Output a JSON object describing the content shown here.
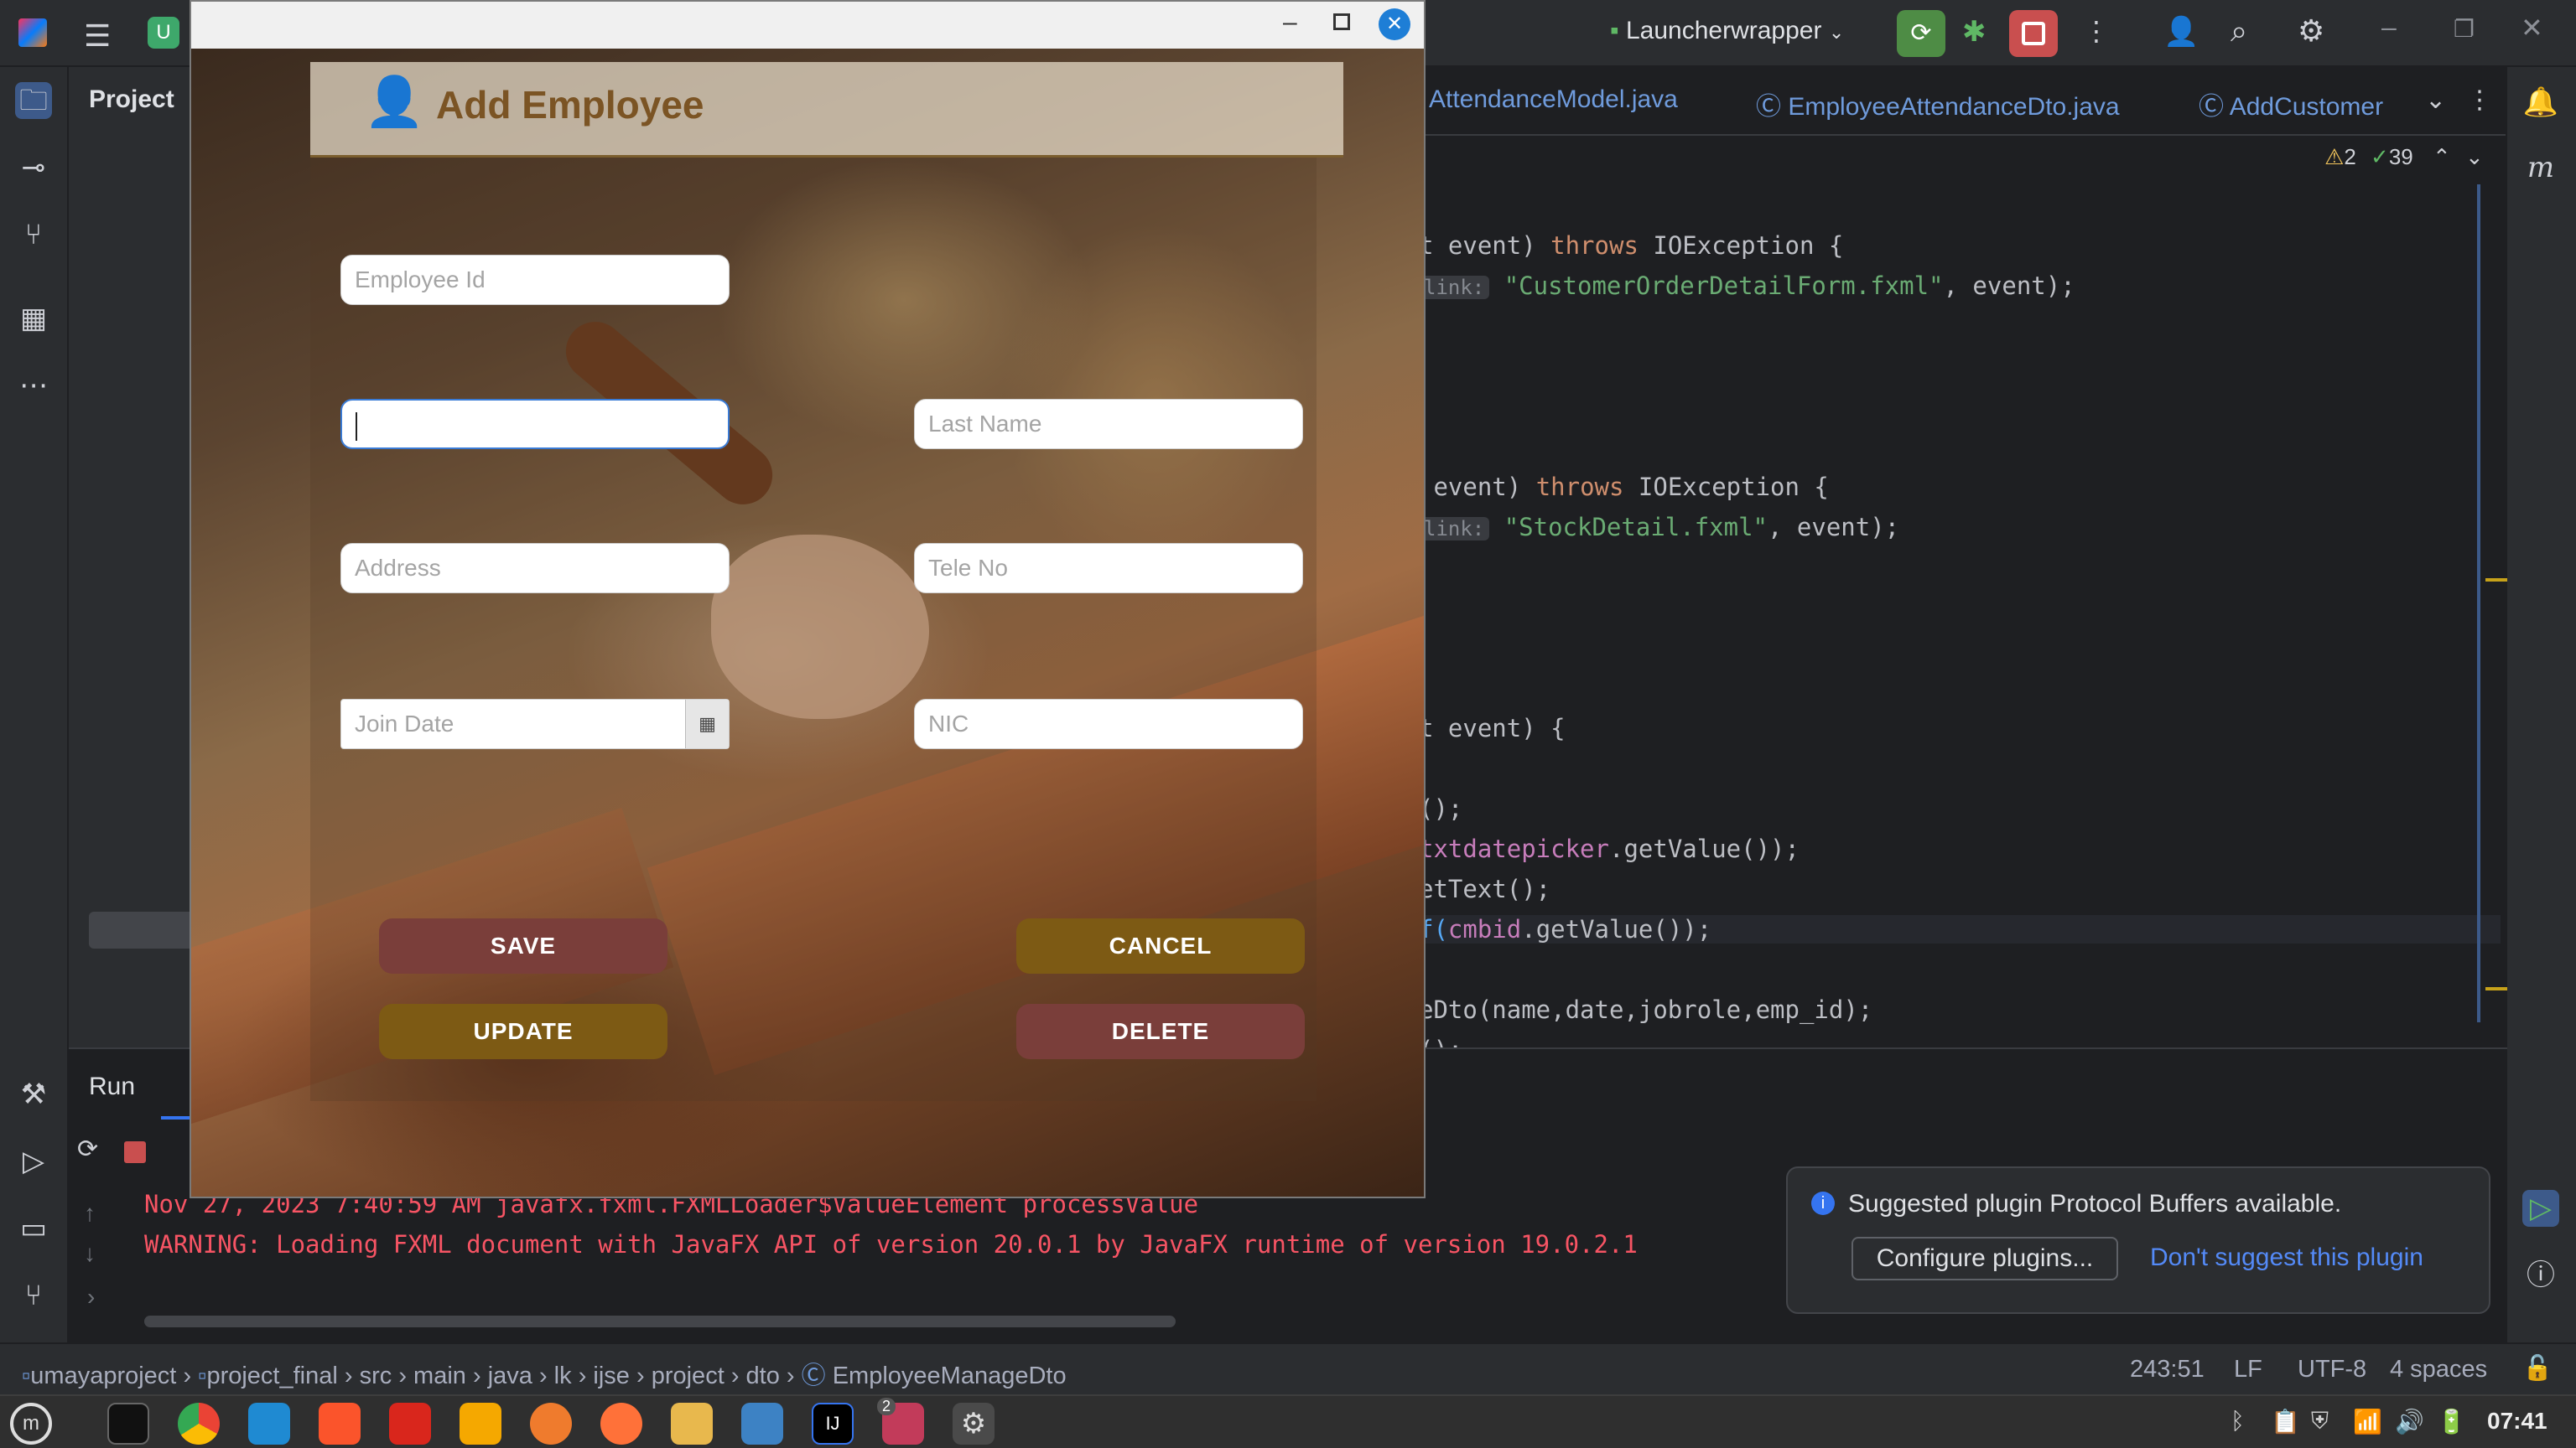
{
  "ide": {
    "run_config": "Launcherwrapper",
    "project_label": "Project",
    "tabs": [
      "AttendanceModel.java",
      "EmployeeAttendanceDto.java",
      "AddCustomer("
    ],
    "inspections": {
      "warnings": "2",
      "ok": "39"
    },
    "code_lines": [
      {
        "pre": "t event) ",
        "kw": "throws",
        "post": " IOException {"
      },
      {
        "hint": "link:",
        "str": "\"CustomerOrderDetailForm.fxml\"",
        "post": ", event);"
      },
      {
        "pre": " event) ",
        "kw": "throws",
        "post": " IOException {"
      },
      {
        "hint": "link:",
        "str": "\"StockDetail.fxml\"",
        "post": ", event);"
      },
      {
        "pre": "t event) {"
      },
      {
        "pre": "();"
      },
      {
        "fn": "txtdatepicker",
        "post": ".getValue());"
      },
      {
        "pre": "etText();"
      },
      {
        "fn": "f(",
        "pur": "cmbid",
        "post": ".getValue());"
      },
      {
        "pre": "eDto(name,date,jobrole,emp_id);"
      },
      {
        "pre": "();"
      }
    ],
    "run": {
      "tab_label": "Run",
      "lines": [
        "Nov 27, 2023 7:40:59 AM javafx.fxml.FXMLLoader$ValueElement processValue",
        "WARNING: Loading FXML document with JavaFX API of version 20.0.1 by JavaFX runtime of version 19.0.2.1"
      ]
    },
    "notification": {
      "message": "Suggested plugin Protocol Buffers available.",
      "configure_label": "Configure plugins...",
      "dismiss_label": "Don't suggest this plugin"
    },
    "breadcrumbs": [
      "umayaproject",
      "project_final",
      "src",
      "main",
      "java",
      "lk",
      "ijse",
      "project",
      "dto",
      "EmployeeManageDto"
    ],
    "status": {
      "position": "243:51",
      "line_sep": "LF",
      "encoding": "UTF-8",
      "indent": "4 spaces"
    },
    "clock": "07:41",
    "taskbar_badge": "2"
  },
  "app": {
    "title": "Add Employee",
    "fields": {
      "employee_id": "Employee Id",
      "first_name": "",
      "last_name": "Last Name",
      "address": "Address",
      "tele_no": "Tele No",
      "join_date": "Join Date",
      "nic": "NIC"
    },
    "buttons": {
      "save": "SAVE",
      "cancel": "CANCEL",
      "update": "UPDATE",
      "delete": "DELETE"
    },
    "colors": {
      "save": "#7a3e3a",
      "delete": "#7a3e3a",
      "cancel": "#7d5a14",
      "update": "#7d5a14",
      "header_text": "#7b5424"
    }
  }
}
